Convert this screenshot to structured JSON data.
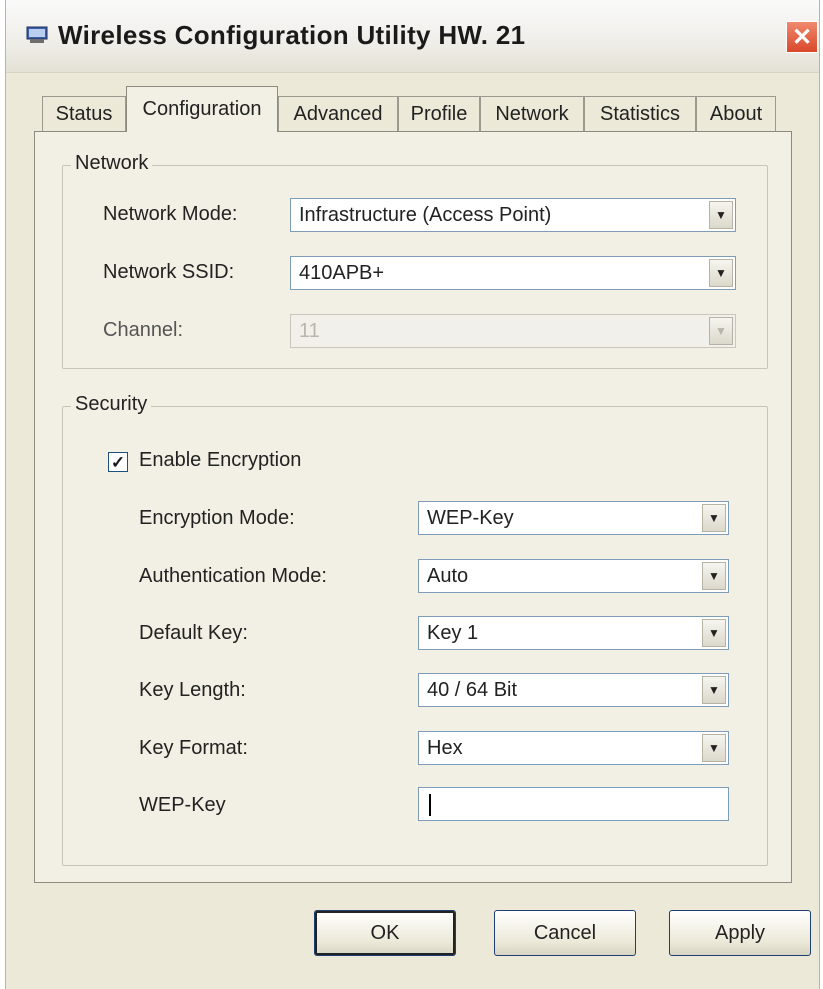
{
  "window": {
    "title": "Wireless Configuration Utility HW. 21",
    "close_glyph": "✕"
  },
  "tabs": [
    {
      "label": "Status"
    },
    {
      "label": "Configuration"
    },
    {
      "label": "Advanced"
    },
    {
      "label": "Profile"
    },
    {
      "label": "Network"
    },
    {
      "label": "Statistics"
    },
    {
      "label": "About"
    }
  ],
  "active_tab": "Configuration",
  "network": {
    "legend": "Network",
    "mode_label": "Network Mode:",
    "mode_value": "Infrastructure (Access Point)",
    "ssid_label": "Network SSID:",
    "ssid_value": "410APB+",
    "channel_label": "Channel:",
    "channel_value": "11"
  },
  "security": {
    "legend": "Security",
    "enable_label": "Enable Encryption",
    "enable_checked": true,
    "encryption_mode_label": "Encryption Mode:",
    "encryption_mode_value": "WEP-Key",
    "auth_mode_label": "Authentication Mode:",
    "auth_mode_value": "Auto",
    "default_key_label": "Default Key:",
    "default_key_value": "Key 1",
    "key_length_label": "Key Length:",
    "key_length_value": "40 / 64 Bit",
    "key_format_label": "Key Format:",
    "key_format_value": "Hex",
    "wep_key_label": "WEP-Key",
    "wep_key_value": ""
  },
  "buttons": {
    "ok": "OK",
    "cancel": "Cancel",
    "apply": "Apply"
  },
  "icons": {
    "app": "wireless-adapter-icon",
    "dropdown": "chevron-down-icon",
    "check": "checkmark-icon",
    "close": "close-icon"
  },
  "colors": {
    "close_button": "#d9472a",
    "dialog_background": "#ece9d8",
    "input_border": "#7f9db9"
  }
}
